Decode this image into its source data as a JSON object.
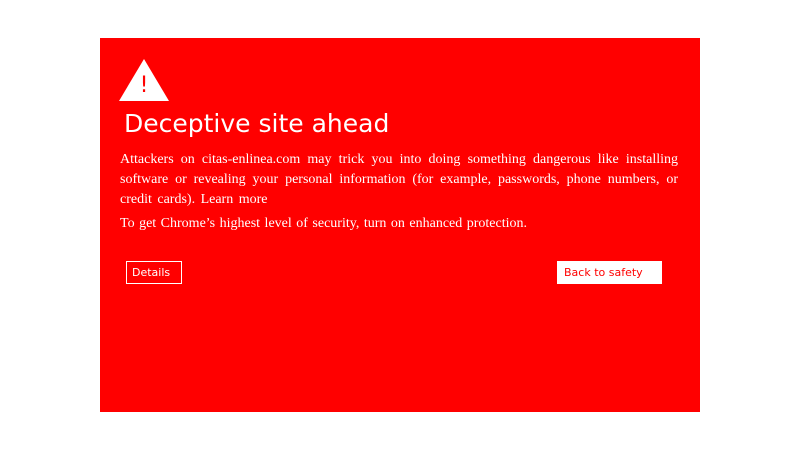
{
  "colors": {
    "page_background": "#ffffff",
    "panel_background": "#ff0000",
    "text": "#ffffff",
    "safety_button_text": "#ff0000",
    "safety_button_background": "#ffffff"
  },
  "icons": {
    "warning": "warning-triangle-icon",
    "warning_glyph": "!"
  },
  "interstitial": {
    "title": "Deceptive site ahead",
    "message_text": "Attackers on citas-enlinea.com may trick you into doing something dangerous like installing software or revealing your personal information (for example, passwords, phone numbers, or credit cards).",
    "learn_more_label": "Learn more",
    "security_text": "To get Chrome’s highest level of security, turn on enhanced protection.",
    "details_label": "Details",
    "back_to_safety_label": "Back to safety"
  }
}
